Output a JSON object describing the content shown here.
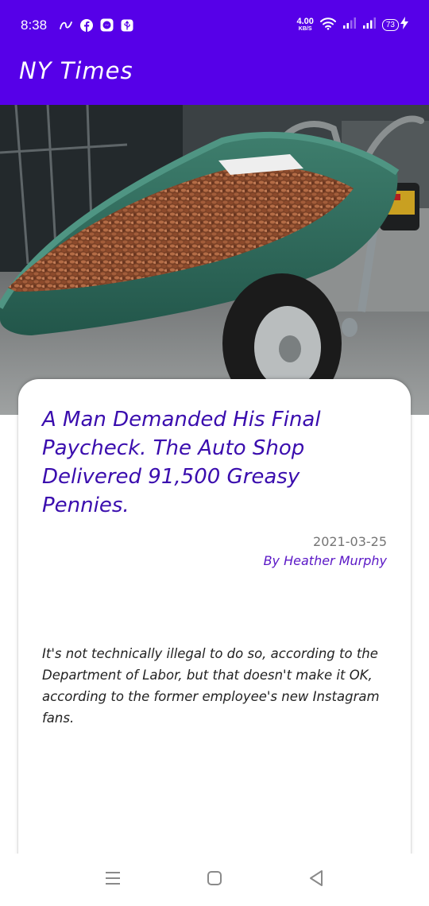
{
  "status_bar": {
    "time": "8:38",
    "network_speed": "4.00",
    "network_speed_unit": "KB/S",
    "battery_level": "73"
  },
  "app_bar": {
    "title": "NY Times"
  },
  "article": {
    "headline": "A Man Demanded His Final Paycheck. The Auto Shop Delivered 91,500 Greasy Pennies.",
    "date": "2021-03-25",
    "byline": "By Heather Murphy",
    "summary": "It's not technically illegal to do so, according to the Department of Labor, but that doesn't make it OK, according to the former employee's new Instagram fans."
  },
  "colors": {
    "app_bar": "#5600e8",
    "headline": "#3a0dae",
    "byline": "#5a17c6"
  },
  "icons": {
    "status_left": [
      "app-notification-icon",
      "facebook-icon",
      "messenger-icon",
      "usb-icon"
    ],
    "status_right": [
      "wifi-icon",
      "signal-icon",
      "signal-icon",
      "battery-icon",
      "charging-icon"
    ],
    "nav": [
      "recent-apps-icon",
      "home-icon",
      "back-icon"
    ]
  }
}
